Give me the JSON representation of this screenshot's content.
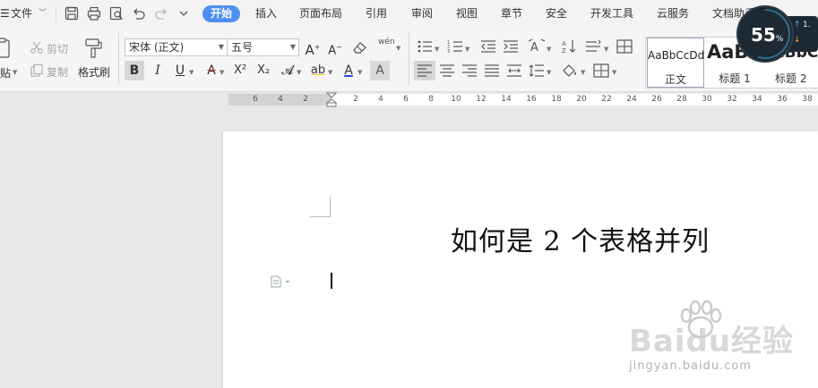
{
  "menubar": {
    "file_label": "文件",
    "tabs": [
      {
        "label": "开始",
        "active": true
      },
      {
        "label": "插入"
      },
      {
        "label": "页面布局"
      },
      {
        "label": "引用"
      },
      {
        "label": "审阅"
      },
      {
        "label": "视图"
      },
      {
        "label": "章节"
      },
      {
        "label": "安全"
      },
      {
        "label": "开发工具"
      },
      {
        "label": "云服务"
      },
      {
        "label": "文档助手"
      }
    ],
    "active_tab_color": "#4d8ff0"
  },
  "ribbon": {
    "clipboard": {
      "paste_label": "贴",
      "cut_label": "剪切",
      "copy_label": "复制",
      "format_painter_label": "格式刷"
    },
    "font": {
      "font_name": "宋体 (正文)",
      "font_size": "五号",
      "bold": "B",
      "italic": "I",
      "underline": "U",
      "text_color_glyph": "A",
      "superscript": "X²",
      "subscript": "X₂",
      "highlight_glyph": "ab",
      "font_color_glyph": "A",
      "char_shading_glyph": "A",
      "pinyin_glyph": "wén"
    },
    "styles": [
      {
        "preview": "AaBbCcDd",
        "name": "正文"
      },
      {
        "preview": "AaBb",
        "name": "标题 1"
      },
      {
        "preview": "AaBbC",
        "name": "标题 2"
      }
    ]
  },
  "ruler": {
    "left_ticks": [
      "6",
      "4",
      "2"
    ],
    "right_ticks": [
      "2",
      "4",
      "6",
      "8",
      "10",
      "12",
      "14",
      "16",
      "18",
      "20",
      "22",
      "24",
      "26",
      "28",
      "30",
      "32",
      "34",
      "36",
      "38"
    ]
  },
  "document": {
    "title": "如何是 2 个表格并列"
  },
  "speed_widget": {
    "value": "55",
    "unit": "%",
    "upload": "1."
  },
  "watermark": {
    "text": "Baidu经验",
    "url": "jingyan.baidu.com"
  }
}
